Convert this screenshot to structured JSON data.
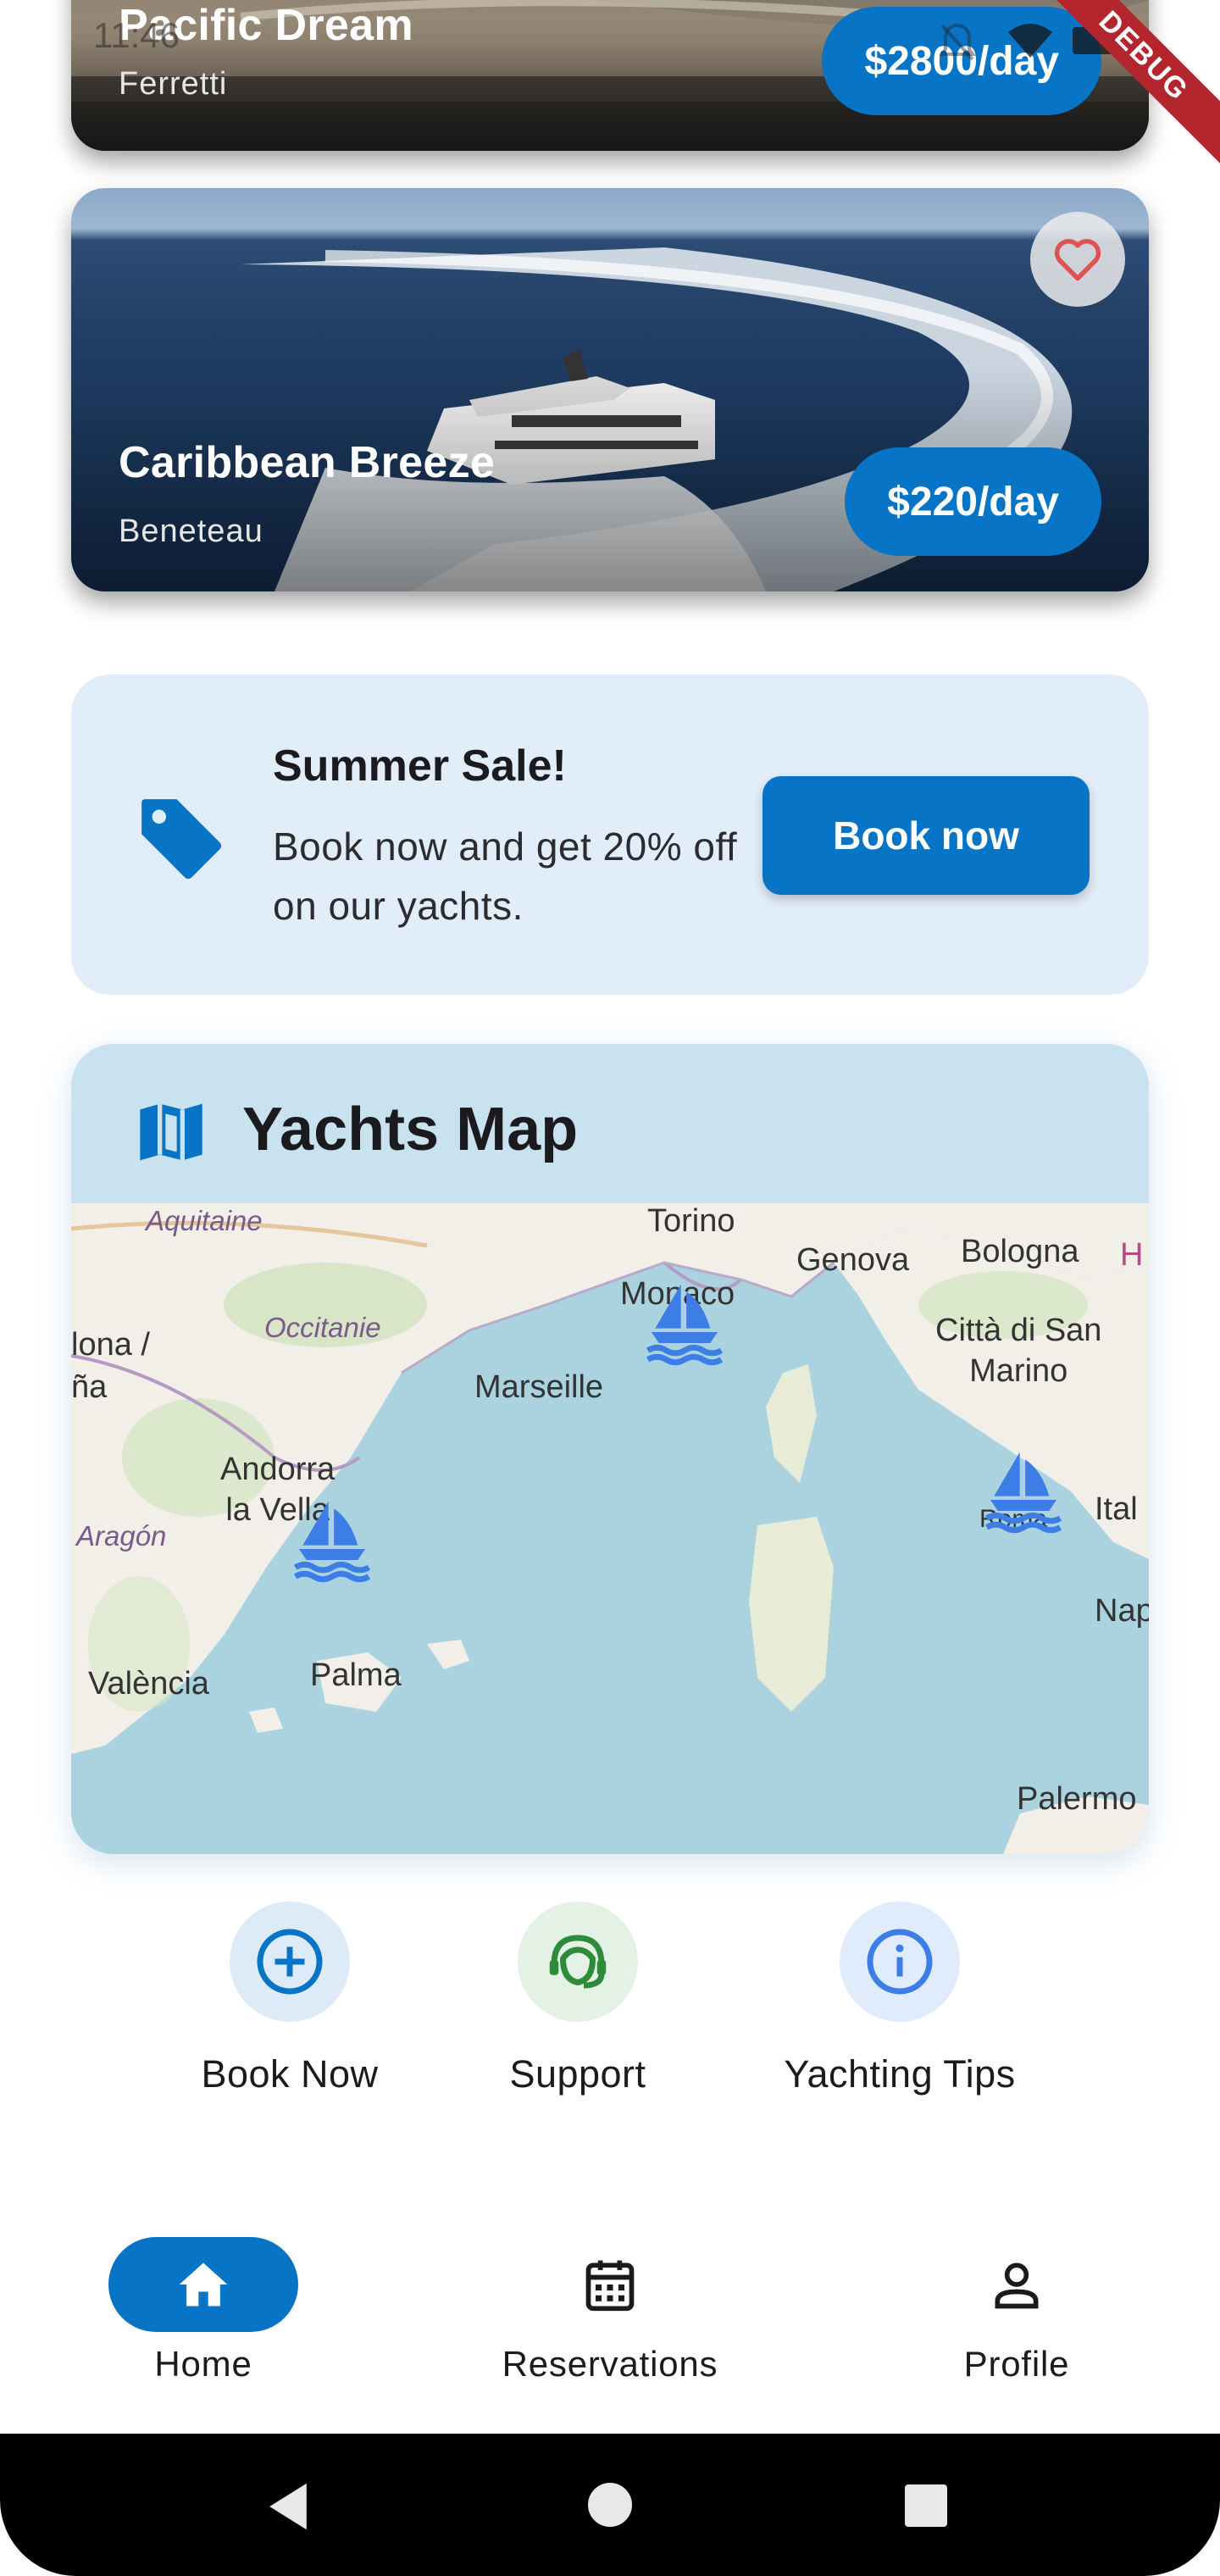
{
  "status_bar": {
    "time": "11:46",
    "debug_label": "DEBUG"
  },
  "yachts": [
    {
      "name": "Pacific Dream",
      "brand": "Ferretti",
      "price": "$2800/day",
      "favorite": false
    },
    {
      "name": "Caribbean Breeze",
      "brand": "Beneteau",
      "price": "$220/day",
      "favorite": false
    }
  ],
  "promo": {
    "title": "Summer Sale!",
    "text": "Book now and get 20% off on our yachts.",
    "button_label": "Book now",
    "icon": "tag-icon"
  },
  "map": {
    "title": "Yachts Map",
    "icon": "map-icon",
    "labels": {
      "aquitaine": "Aquitaine",
      "occitanie": "Occitanie",
      "torino": "Torino",
      "genova": "Genova",
      "bologna": "Bologna",
      "monaco": "Monaco",
      "marseille": "Marseille",
      "lona": "lona /",
      "na": "ña",
      "san_marino": "Città di San\nMarino",
      "andorra": "Andorra\nla Vella",
      "aragon": "Aragón",
      "valencia": "València",
      "palma": "Palma",
      "roma": "Roma",
      "ital": "Ital",
      "nap": "Nap",
      "palermo": "Palermo",
      "h": "H"
    },
    "markers": [
      "sailboat-icon",
      "sailboat-icon",
      "sailboat-icon"
    ]
  },
  "quick_actions": [
    {
      "label": "Book Now",
      "icon": "add-circle-icon",
      "color": "#0874c6",
      "bg": "#dcebf7"
    },
    {
      "label": "Support",
      "icon": "support-agent-icon",
      "color": "#2e8b3a",
      "bg": "#e3f2e4"
    },
    {
      "label": "Yachting Tips",
      "icon": "info-icon",
      "color": "#3d7de6",
      "bg": "#e0ecfb"
    }
  ],
  "bottom_nav": [
    {
      "label": "Home",
      "icon": "home-icon",
      "active": true
    },
    {
      "label": "Reservations",
      "icon": "calendar-icon",
      "active": false
    },
    {
      "label": "Profile",
      "icon": "person-icon",
      "active": false
    }
  ],
  "colors": {
    "primary": "#0874c6",
    "promo_bg": "#e1edf8",
    "map_header": "#c9e2f0",
    "water": "#aad3df",
    "land": "#f2efe9"
  }
}
